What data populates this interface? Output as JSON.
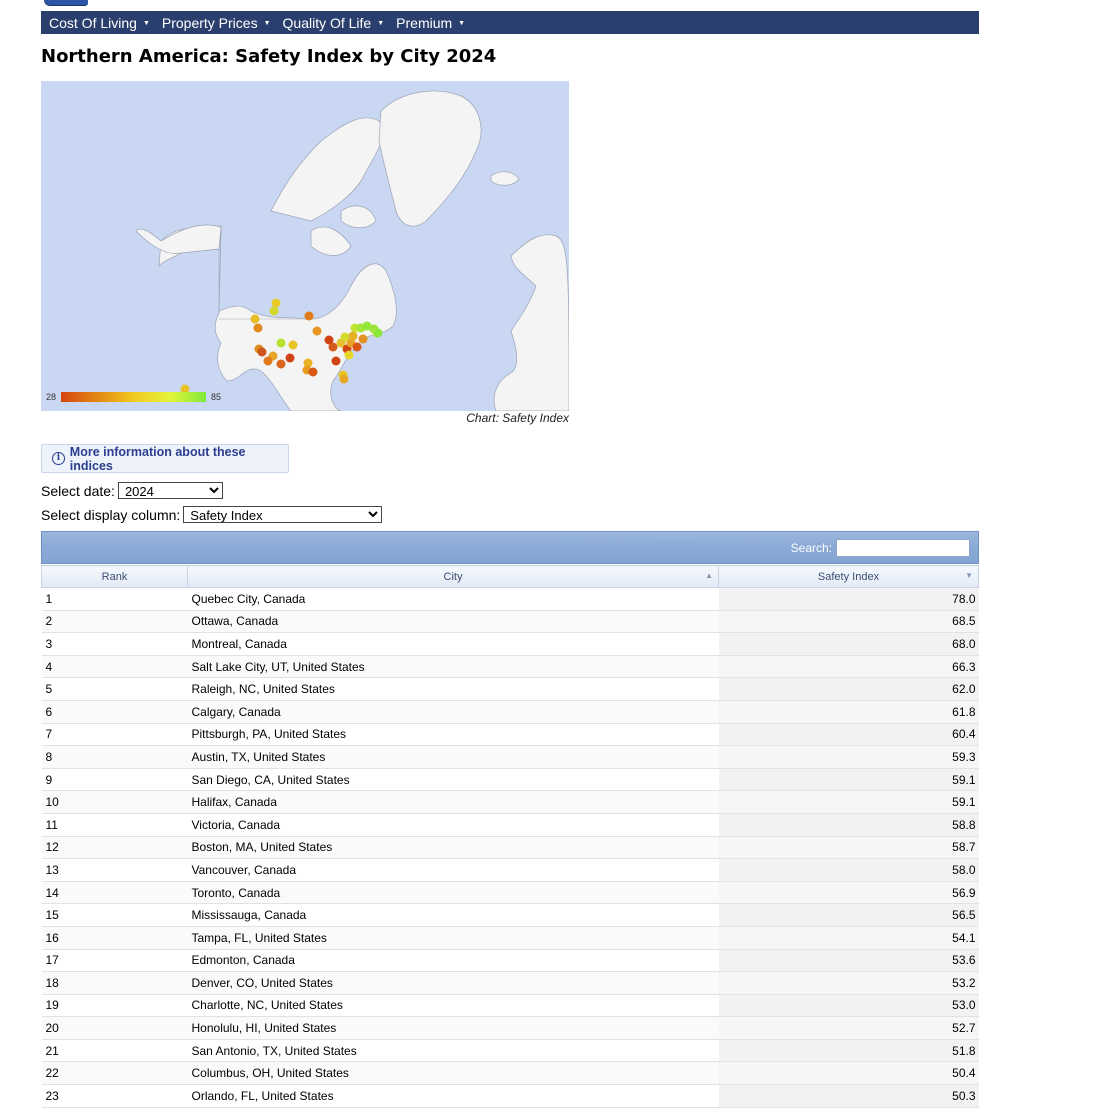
{
  "nav": {
    "items": [
      {
        "label": "Cost Of Living"
      },
      {
        "label": "Property Prices"
      },
      {
        "label": "Quality Of Life"
      },
      {
        "label": "Premium"
      }
    ]
  },
  "page": {
    "title": "Northern America: Safety Index by City 2024"
  },
  "map": {
    "legend_min": "28",
    "legend_max": "85",
    "caption": "Chart: Safety Index",
    "colors": {
      "ocean": "#c9d7f2",
      "land": "#f4f4f4",
      "low": "#d4440c",
      "mid": "#f2ca1f",
      "high": "#7fea3a"
    }
  },
  "info_button": {
    "label": "More information about these indices"
  },
  "controls": {
    "date_label": "Select date:",
    "date_value": "2024",
    "column_label": "Select display column:",
    "column_value": "Safety Index"
  },
  "table": {
    "search_label": "Search:",
    "headers": {
      "rank": "Rank",
      "city": "City",
      "value": "Safety Index"
    },
    "rows": [
      {
        "rank": "1",
        "city": "Quebec City, Canada",
        "value": "78.0"
      },
      {
        "rank": "2",
        "city": "Ottawa, Canada",
        "value": "68.5"
      },
      {
        "rank": "3",
        "city": "Montreal, Canada",
        "value": "68.0"
      },
      {
        "rank": "4",
        "city": "Salt Lake City, UT, United States",
        "value": "66.3"
      },
      {
        "rank": "5",
        "city": "Raleigh, NC, United States",
        "value": "62.0"
      },
      {
        "rank": "6",
        "city": "Calgary, Canada",
        "value": "61.8"
      },
      {
        "rank": "7",
        "city": "Pittsburgh, PA, United States",
        "value": "60.4"
      },
      {
        "rank": "8",
        "city": "Austin, TX, United States",
        "value": "59.3"
      },
      {
        "rank": "9",
        "city": "San Diego, CA, United States",
        "value": "59.1"
      },
      {
        "rank": "10",
        "city": "Halifax, Canada",
        "value": "59.1"
      },
      {
        "rank": "11",
        "city": "Victoria, Canada",
        "value": "58.8"
      },
      {
        "rank": "12",
        "city": "Boston, MA, United States",
        "value": "58.7"
      },
      {
        "rank": "13",
        "city": "Vancouver, Canada",
        "value": "58.0"
      },
      {
        "rank": "14",
        "city": "Toronto, Canada",
        "value": "56.9"
      },
      {
        "rank": "15",
        "city": "Mississauga, Canada",
        "value": "56.5"
      },
      {
        "rank": "16",
        "city": "Tampa, FL, United States",
        "value": "54.1"
      },
      {
        "rank": "17",
        "city": "Edmonton, Canada",
        "value": "53.6"
      },
      {
        "rank": "18",
        "city": "Denver, CO, United States",
        "value": "53.2"
      },
      {
        "rank": "19",
        "city": "Charlotte, NC, United States",
        "value": "53.0"
      },
      {
        "rank": "20",
        "city": "Honolulu, HI, United States",
        "value": "52.7"
      },
      {
        "rank": "21",
        "city": "San Antonio, TX, United States",
        "value": "51.8"
      },
      {
        "rank": "22",
        "city": "Columbus, OH, United States",
        "value": "50.4"
      },
      {
        "rank": "23",
        "city": "Orlando, FL, United States",
        "value": "50.3"
      }
    ]
  }
}
